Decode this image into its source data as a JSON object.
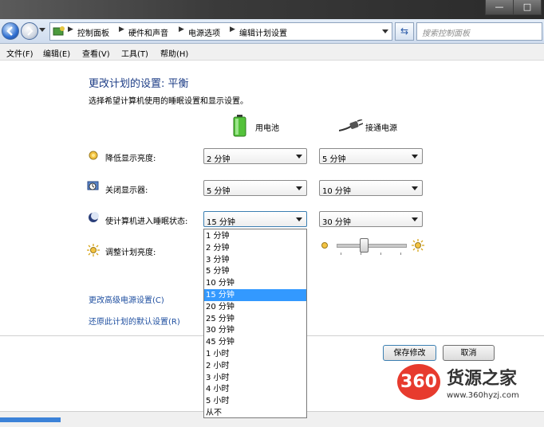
{
  "window": {
    "min": "—",
    "max": "□"
  },
  "address": {
    "breadcrumbs": [
      "控制面板",
      "硬件和声音",
      "电源选项",
      "编辑计划设置"
    ],
    "search_placeholder": "搜索控制面板"
  },
  "menu": [
    "文件(F)",
    "编辑(E)",
    "查看(V)",
    "工具(T)",
    "帮助(H)"
  ],
  "page": {
    "title": "更改计划的设置: 平衡",
    "subtitle": "选择希望计算机使用的睡眠设置和显示设置。",
    "col_battery": "用电池",
    "col_plugged": "接通电源"
  },
  "settings": [
    {
      "label": "降低显示亮度:",
      "battery": "2 分钟",
      "plugged": "5 分钟"
    },
    {
      "label": "关闭显示器:",
      "battery": "5 分钟",
      "plugged": "10 分钟"
    },
    {
      "label": "使计算机进入睡眠状态:",
      "battery": "15 分钟",
      "plugged": "30 分钟"
    },
    {
      "label": "调整计划亮度:"
    }
  ],
  "brightness": {
    "plugged_level": 0.4
  },
  "links": {
    "advanced": "更改高级电源设置(C)",
    "restore": "还原此计划的默认设置(R)"
  },
  "dropdown": {
    "options": [
      "1 分钟",
      "2 分钟",
      "3 分钟",
      "5 分钟",
      "10 分钟",
      "15 分钟",
      "20 分钟",
      "25 分钟",
      "30 分钟",
      "45 分钟",
      "1 小时",
      "2 小时",
      "3 小时",
      "4 小时",
      "5 小时",
      "从不"
    ],
    "selected_index": 5
  },
  "buttons": {
    "save": "保存修改",
    "cancel": "取消"
  },
  "watermark": {
    "badge": "360",
    "title": "货源之家",
    "url": "www.360hyzj.com"
  },
  "colors": {
    "selection": "#3399ff",
    "link": "#1f4fa0",
    "watermark": "#e73b2e"
  }
}
